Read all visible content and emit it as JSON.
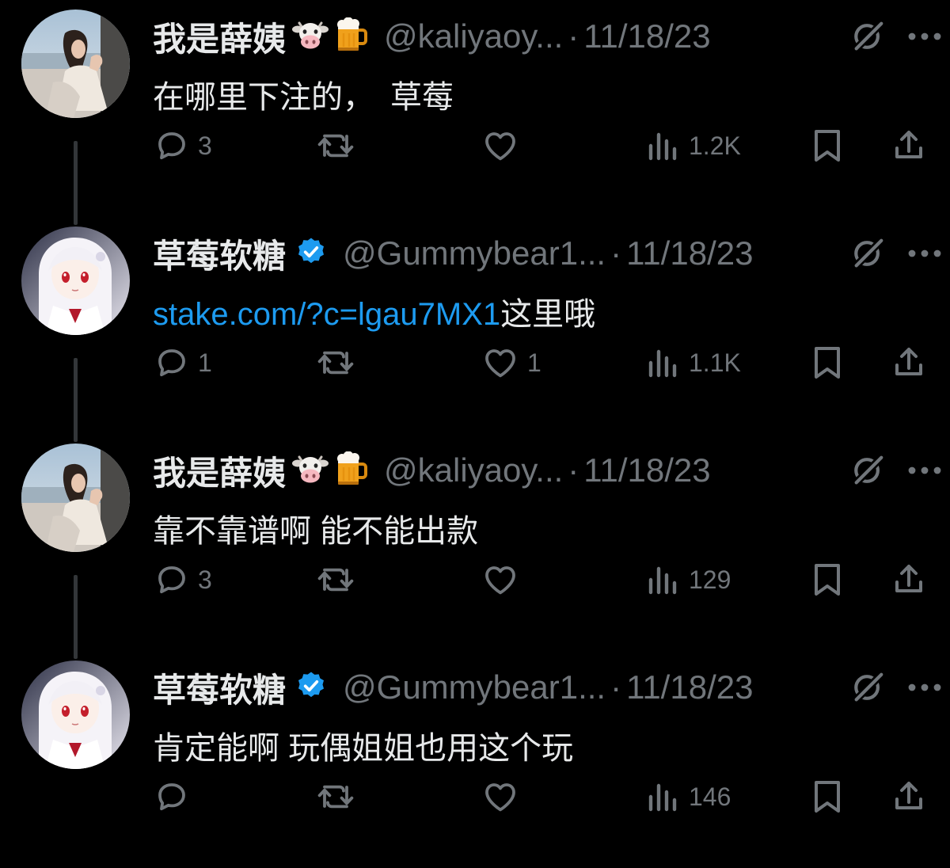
{
  "tweets": [
    {
      "name": "我是薛姨",
      "handle": "@kaliyaoy...",
      "dot": "·",
      "date": "11/18/23",
      "text": "在哪里下注的，　草莓",
      "link": "",
      "verified": false,
      "emojis": [
        "cow-face",
        "beer-mug"
      ],
      "avatar": "photo-woman",
      "replies": "3",
      "retweets": "",
      "likes": "",
      "views": "1.2K"
    },
    {
      "name": "草莓软糖",
      "handle": "@Gummybear1...",
      "dot": "·",
      "date": "11/18/23",
      "text": "这里哦",
      "link": "stake.com/?c=lgau7MX1",
      "verified": true,
      "emojis": [],
      "avatar": "anime-girl",
      "replies": "1",
      "retweets": "",
      "likes": "1",
      "views": "1.1K"
    },
    {
      "name": "我是薛姨",
      "handle": "@kaliyaoy...",
      "dot": "·",
      "date": "11/18/23",
      "text": "靠不靠谱啊  能不能出款",
      "link": "",
      "verified": false,
      "emojis": [
        "cow-face",
        "beer-mug"
      ],
      "avatar": "photo-woman",
      "replies": "3",
      "retweets": "",
      "likes": "",
      "views": "129"
    },
    {
      "name": "草莓软糖",
      "handle": "@Gummybear1...",
      "dot": "·",
      "date": "11/18/23",
      "text": "肯定能啊 玩偶姐姐也用这个玩",
      "link": "",
      "verified": true,
      "emojis": [],
      "avatar": "anime-girl",
      "replies": "",
      "retweets": "",
      "likes": "",
      "views": "146"
    }
  ],
  "colors": {
    "background": "#000000",
    "text": "#e7e9ea",
    "muted": "#71767b",
    "link": "#1d9bf0",
    "verified": "#1d9bf0",
    "thread_line": "#333639"
  },
  "icons": [
    "reply-icon",
    "retweet-icon",
    "like-icon",
    "views-icon",
    "bookmark-icon",
    "share-icon",
    "grok-icon",
    "more-icon"
  ]
}
